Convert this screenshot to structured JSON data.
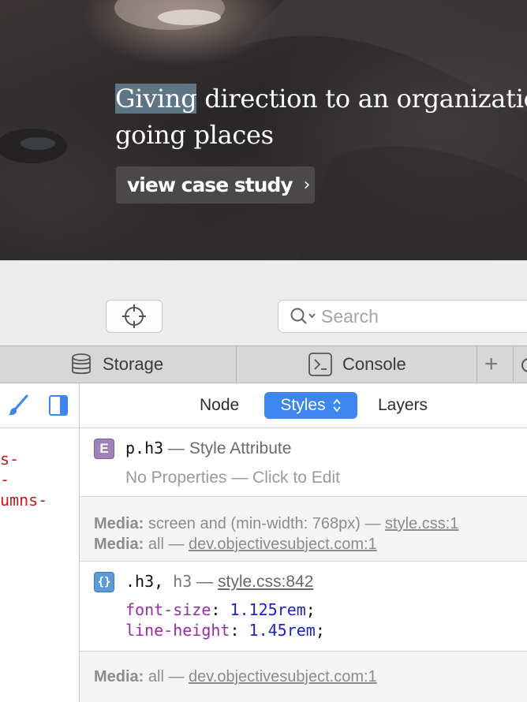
{
  "hero": {
    "headline_selected": "Giving",
    "headline_rest_line1": " direction to an organizatio",
    "headline_line2": "going places",
    "cta_label": "view case study",
    "cta_chevron": "›"
  },
  "toolbar": {
    "search_placeholder": "Search"
  },
  "tabs": [
    {
      "label": "Storage",
      "icon": "database-icon"
    },
    {
      "label": "Console",
      "icon": "console-icon"
    }
  ],
  "add_tab_label": "+",
  "left_panel": {
    "code_fragments": [
      "s-",
      "-",
      "umns-"
    ]
  },
  "subtabs": {
    "node": "Node",
    "styles": "Styles",
    "layers": "Layers"
  },
  "rules": {
    "attr": {
      "badge": "E",
      "selector": "p.h3",
      "origin": " — Style Attribute",
      "empty": "No Properties — Click to Edit"
    },
    "media1": {
      "line1_label": "Media:",
      "line1_query": " screen and (min-width: 768px) — ",
      "line1_link": "style.css:1",
      "line2_label": "Media:",
      "line2_query": " all — ",
      "line2_link": "dev.objectivesubject.com:1"
    },
    "h3": {
      "badge": "{}",
      "selector": ".h3",
      "selector_sep": ", ",
      "selector_extra": "h3",
      "origin_sep": " — ",
      "origin_link": "style.css:842",
      "declarations": [
        {
          "prop": "font-size",
          "value": "1.125rem"
        },
        {
          "prop": "line-height",
          "value": "1.45rem"
        }
      ]
    },
    "media2": {
      "label": "Media:",
      "query": " all — ",
      "link": "dev.objectivesubject.com:1"
    }
  },
  "colors": {
    "accent": "#3d86f0",
    "property": "#9a2aa6",
    "value": "#1f23c7",
    "selection": "#5e7583"
  }
}
